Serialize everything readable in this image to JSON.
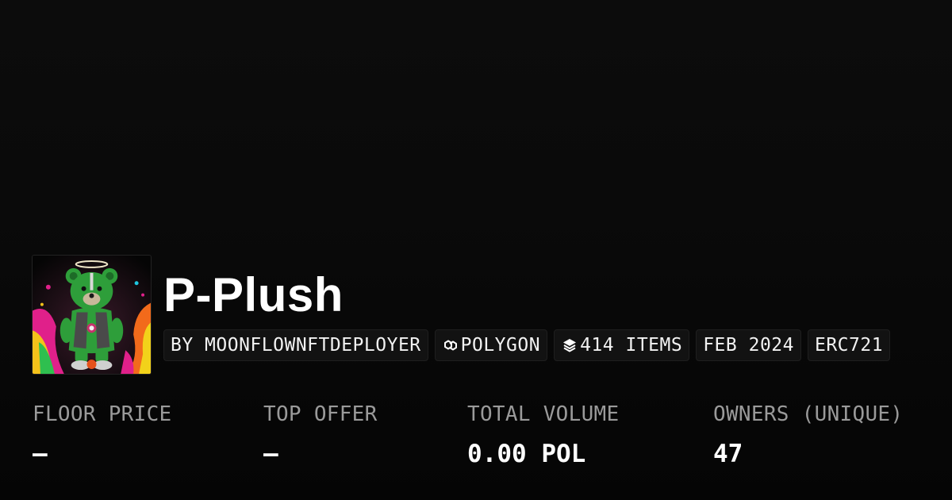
{
  "collection": {
    "name": "P-Plush",
    "image_alt": "green-plush-bear-artwork"
  },
  "chips": [
    {
      "icon": "",
      "label": "BY MOONFLOWNFTDEPLOYER"
    },
    {
      "icon": "polygon-link-icon",
      "label": "POLYGON"
    },
    {
      "icon": "layers-icon",
      "label": "414 ITEMS"
    },
    {
      "icon": "",
      "label": "FEB 2024"
    },
    {
      "icon": "",
      "label": "ERC721"
    }
  ],
  "stats": [
    {
      "label": "FLOOR PRICE",
      "value": "—"
    },
    {
      "label": "TOP OFFER",
      "value": "—"
    },
    {
      "label": "TOTAL VOLUME",
      "value": "0.00 POL"
    },
    {
      "label": "OWNERS (UNIQUE)",
      "value": "47"
    }
  ],
  "colors": {
    "background": "#0a0a0a",
    "chip_background": "#121212",
    "label_gray": "#9a9a9a",
    "text_white": "#ffffff",
    "bear_green": "#2e9e3a"
  }
}
